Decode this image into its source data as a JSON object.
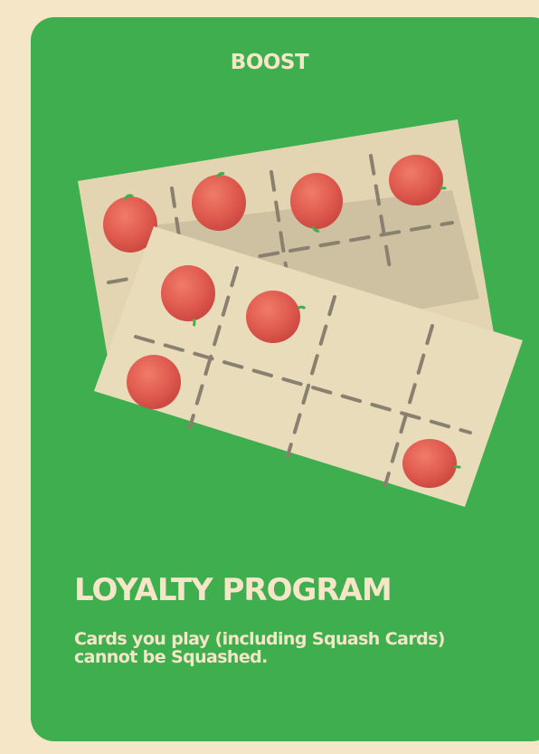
{
  "card": {
    "category": "BOOST",
    "title": "LOYALTY PROGRAM",
    "description": "Cards you play (including Squash Cards) cannot be Squashed."
  },
  "colors": {
    "background": "#f6e6c8",
    "card": "#3fae4f",
    "ticket": "#e6d8b4",
    "apple": "#de5a4f",
    "stem": "#3fae4f",
    "grid_line": "#8a8070"
  },
  "illustration": {
    "icon": "punch-card-apples-icon",
    "back_ticket_apples": 4,
    "front_ticket_apples": 4
  }
}
